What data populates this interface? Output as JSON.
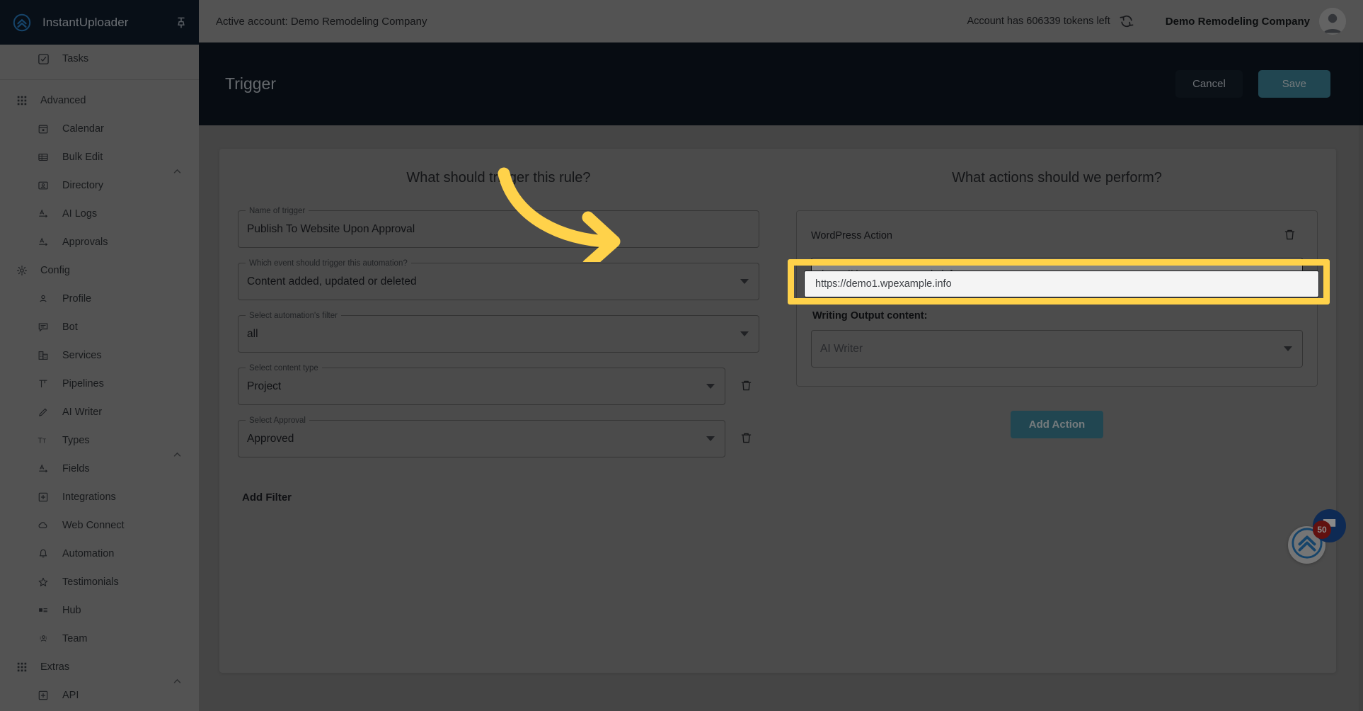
{
  "brand": {
    "name": "InstantUploader",
    "logo_icon": "chevrons-up-circle-icon",
    "pin_icon": "pin-icon"
  },
  "sidebar": {
    "top_items": [
      {
        "label": "Tasks",
        "icon": "checkbox-icon"
      }
    ],
    "groups": [
      {
        "label": "Advanced",
        "icon": "grid-apps-icon",
        "chevron": "chevron-up-icon",
        "items": [
          {
            "label": "Calendar",
            "icon": "calendar-icon"
          },
          {
            "label": "Bulk Edit",
            "icon": "table-rows-icon"
          },
          {
            "label": "Directory",
            "icon": "contact-card-icon"
          },
          {
            "label": "AI Logs",
            "icon": "text-field-icon"
          },
          {
            "label": "Approvals",
            "icon": "text-field-icon"
          }
        ]
      },
      {
        "label": "Config",
        "icon": "gear-icon",
        "chevron": "chevron-up-icon",
        "items": [
          {
            "label": "Profile",
            "icon": "person-icon"
          },
          {
            "label": "Bot",
            "icon": "chat-lines-icon"
          },
          {
            "label": "Services",
            "icon": "building-icon"
          },
          {
            "label": "Pipelines",
            "icon": "pipeline-icon"
          },
          {
            "label": "AI Writer",
            "icon": "pencil-icon"
          },
          {
            "label": "Types",
            "icon": "text-format-icon"
          },
          {
            "label": "Fields",
            "icon": "text-field-icon"
          },
          {
            "label": "Integrations",
            "icon": "plus-square-icon"
          },
          {
            "label": "Web Connect",
            "icon": "cloud-icon"
          },
          {
            "label": "Automation",
            "icon": "bell-icon"
          },
          {
            "label": "Testimonials",
            "icon": "star-icon"
          },
          {
            "label": "Hub",
            "icon": "article-icon"
          },
          {
            "label": "Team",
            "icon": "people-icon"
          }
        ]
      },
      {
        "label": "Extras",
        "icon": "grid-apps-icon",
        "chevron": "chevron-up-icon",
        "items": [
          {
            "label": "API",
            "icon": "plus-square-icon"
          }
        ]
      }
    ]
  },
  "topbar": {
    "active_account_text": "Active account: Demo Remodeling Company",
    "tokens_text": "Account has 606339 tokens left",
    "refresh_icon": "refresh-icon",
    "account_name": "Demo Remodeling Company",
    "avatar_icon": "avatar-icon"
  },
  "page_header": {
    "title": "Trigger",
    "cancel_label": "Cancel",
    "save_label": "Save"
  },
  "trigger_column": {
    "title": "What should trigger this rule?",
    "fields": [
      {
        "legend": "Name of trigger",
        "value": "Publish To Website Upon Approval",
        "type": "text",
        "has_delete": false
      },
      {
        "legend": "Which event should trigger this automation?",
        "value": "Content added, updated or deleted",
        "type": "select",
        "has_delete": false
      },
      {
        "legend": "Select automation's filter",
        "value": "all",
        "type": "select",
        "has_delete": false
      },
      {
        "legend": "Select content type",
        "value": "Project",
        "type": "select",
        "has_delete": true
      },
      {
        "legend": "Select Approval",
        "value": "Approved",
        "type": "select",
        "has_delete": true
      }
    ],
    "add_filter_label": "Add Filter"
  },
  "actions_column": {
    "title": "What actions should we perform?",
    "action_name": "WordPress Action",
    "delete_icon": "trash-icon",
    "url_value": "https://demo1.wpexample.info",
    "writing_output_label": "Writing Output content:",
    "writing_output_value": "AI Writer",
    "add_action_label": "Add Action"
  },
  "annotations": {
    "highlight_color": "#FFD24A",
    "arrow_color": "#FFD24A",
    "arrow_icon": "curved-arrow-right-icon",
    "highlighted_value": "https://demo1.wpexample.info"
  },
  "floating": {
    "chat_icon": "chat-bubble-icon",
    "badge_count": "50",
    "logo_icon": "chevrons-up-circle-icon"
  },
  "colors": {
    "accent_teal": "#3d8296",
    "header_dark": "#0d1722",
    "highlight_yellow": "#FFD24A",
    "badge_red": "#B4211F",
    "chat_blue": "#1B4F9C"
  }
}
